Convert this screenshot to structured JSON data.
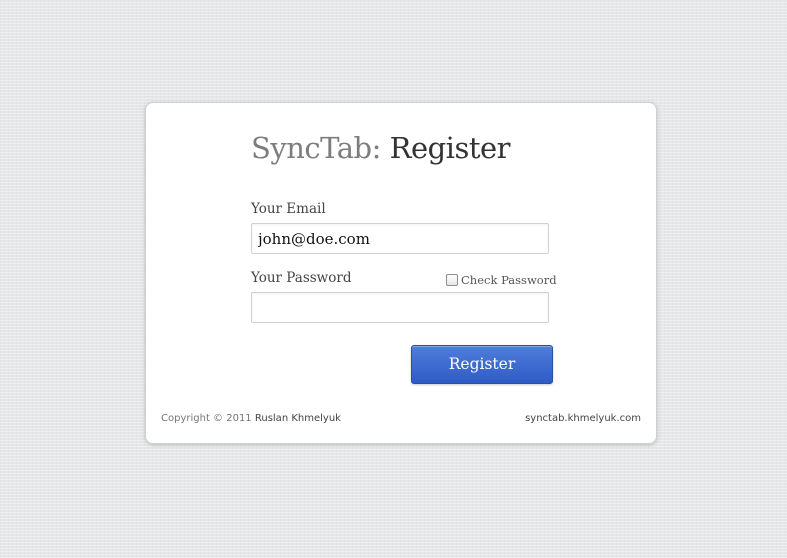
{
  "app": {
    "brand": "SyncTab:",
    "page_title": "Register"
  },
  "form": {
    "email_label": "Your Email",
    "email_value": "john@doe.com",
    "password_label": "Your Password",
    "password_value": "",
    "check_password_label": "Check Password",
    "check_password_checked": false,
    "submit_label": "Register"
  },
  "footer": {
    "copyright": "Copyright © 2011",
    "author": "Ruslan Khmelyuk",
    "site": "synctab.khmelyuk.com"
  },
  "colors": {
    "accent": "#3a66cf",
    "background": "#e6e7e9"
  }
}
